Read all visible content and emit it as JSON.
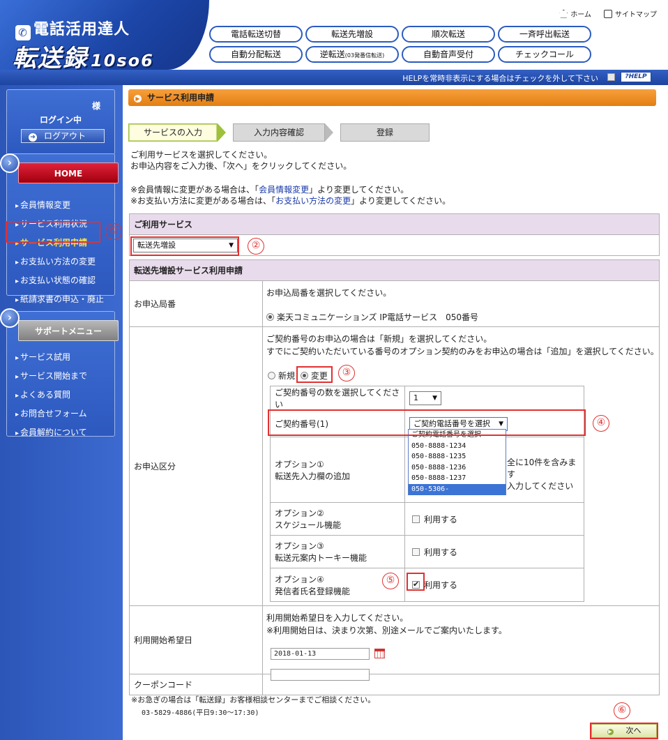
{
  "header": {
    "logo_sub": "電話活用達人",
    "logo_main": "転送録",
    "logo_suffix": "10so6",
    "home_link": "ホーム",
    "sitemap_link": "サイトマップ",
    "nav_row1": [
      "電話転送切替",
      "転送先増設",
      "順次転送",
      "一斉呼出転送"
    ],
    "nav_row2": [
      "自動分配転送",
      "逆転送",
      "自動音声受付",
      "チェックコール"
    ],
    "nav_row2_small": "(03発番信転送)",
    "help_text": "HELPを常時非表示にする場合はチェックを外して下さい",
    "help_button": "?HELP"
  },
  "sidebar": {
    "user_suffix": "様",
    "login_status": "ログイン中",
    "logout": "ログアウト",
    "home": "HOME",
    "menu": [
      "会員情報変更",
      "サービス利用状況",
      "サービス利用申請",
      "お支払い方法の変更",
      "お支払い状態の確認",
      "紙請求書の申込・廃止"
    ],
    "support_title": "サポートメニュー",
    "support": [
      "サービス試用",
      "サービス開始まで",
      "よくある質問",
      "お問合せフォーム",
      "会員解約について"
    ]
  },
  "main": {
    "title": "サービス利用申請",
    "steps": [
      "サービスの入力",
      "入力内容確認",
      "登録"
    ],
    "intro1": "ご利用サービスを選択してください。",
    "intro2": "お申込内容をご入力後、「次へ」をクリックしてください。",
    "note1_pre": "※会員情報に変更がある場合は、「",
    "note1_link": "会員情報変更",
    "note1_post": "」より変更してください。",
    "note2_pre": "※お支払い方法に変更がある場合は、「",
    "note2_link": "お支払い方法の変更",
    "note2_post": "」より変更してください。",
    "service_head": "ご利用サービス",
    "service_value": "転送先増設",
    "form_head": "転送先増設サービス利用申請",
    "office_label": "お申込局番",
    "office_prompt": "お申込局番を選択してください。",
    "office_option": "楽天コミュニケーションズ IP電話サービス　050番号",
    "kind_label": "お申込区分",
    "kind_desc1": "ご契約番号のお申込の場合は「新規」を選択してください。",
    "kind_desc2": "すでにご契約いただいている番号のオプション契約のみをお申込の場合は「追加」を選択してください。",
    "radio_new": "新規",
    "radio_change": "変更",
    "count_label": "ご契約番号の数を選択してください",
    "count_value": "1",
    "contract_label": "ご契約番号(1)",
    "contract_select": "ご契約電話番号を選択",
    "contract_options": [
      "ご契約電話番号を選択",
      "050-8888-1234",
      "050-8888-1235",
      "050-8888-1236",
      "050-8888-1237",
      "050-5306-"
    ],
    "opt1_title": "オプション①",
    "opt1_desc": "転送先入力欄の追加",
    "opt1_note1": "全に10件を含みます",
    "opt1_note2": "入力してください",
    "opt2_title": "オプション②",
    "opt2_desc": "スケジュール機能",
    "opt3_title": "オプション③",
    "opt3_desc": "転送元案内トーキー機能",
    "opt4_title": "オプション④",
    "opt4_desc": "発信者氏名登録機能",
    "use_label": "利用する",
    "start_label": "利用開始希望日",
    "start_desc1": "利用開始希望日を入力してください。",
    "start_desc2": "※利用開始日は、決まり次第、別途メールでご案内いたします。",
    "start_value": "2018-01-13",
    "coupon_label": "クーポンコード",
    "coupon_value": "",
    "footer1": "※お急ぎの場合は「転送録」お客様相談センターまでご相談ください。",
    "footer2": "03-5829-4886(平日9:30～17:30)",
    "next": "次へ"
  },
  "annotations": [
    "①",
    "②",
    "③",
    "④",
    "⑤",
    "⑥"
  ]
}
